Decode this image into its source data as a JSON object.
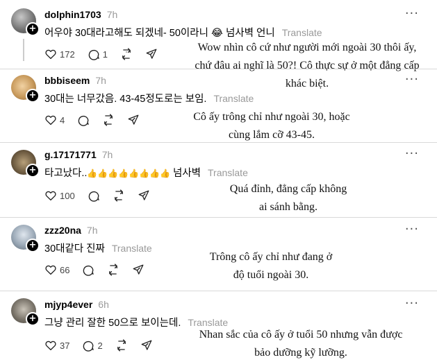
{
  "posts": [
    {
      "username": "dolphin1703",
      "time": "7h",
      "text": "어우야 30대라고해도 되겠네- 50이라니",
      "emoji": "😂",
      "text_after": "넘사벽 언니",
      "translate": "Translate",
      "likes": "172",
      "replies": "1",
      "overlay": [
        "Wow nhìn cô cứ như người mới ngoài 30 thôi ấy,",
        "chứ đâu ai nghĩ là 50?! Cô thực sự ở một đẳng cấp",
        "khác biệt."
      ]
    },
    {
      "username": "bbbiseem",
      "time": "7h",
      "text": "30대는 너무갔음. 43-45정도로는 보임.",
      "translate": "Translate",
      "likes": "4",
      "replies": "",
      "overlay": [
        "Cô ấy trông chỉ như ngoài 30, hoặc",
        "cùng lắm cỡ 43-45."
      ]
    },
    {
      "username": "g.17171771",
      "time": "7h",
      "text": "타고났다..",
      "emoji": "👍👍👍👍👍👍👍👍",
      "text_after": "넘사벽",
      "translate": "Translate",
      "likes": "100",
      "replies": "",
      "overlay": [
        "Quá đỉnh, đẳng cấp không",
        "ai sánh bằng."
      ]
    },
    {
      "username": "zzz20na",
      "time": "7h",
      "text": "30대같다 진짜",
      "translate": "Translate",
      "likes": "66",
      "replies": "",
      "overlay": [
        "Trông cô ấy chỉ như đang ở",
        "độ tuổi ngoài 30."
      ]
    },
    {
      "username": "mjyp4ever",
      "time": "6h",
      "text": "그냥 관리 잘한 50으로 보이는데.",
      "translate": "Translate",
      "likes": "37",
      "replies": "2",
      "overlay": [
        "Nhan sắc của cô ấy ở tuổi 50 nhưng vẫn được",
        "bảo dưỡng kỹ lưỡng."
      ]
    }
  ],
  "icons": {
    "like": "heart-icon",
    "reply": "comment-icon",
    "repost": "repost-icon",
    "share": "send-icon",
    "more": "more-icon",
    "follow": "plus-icon"
  },
  "more_glyph": "···",
  "plus_glyph": "+"
}
